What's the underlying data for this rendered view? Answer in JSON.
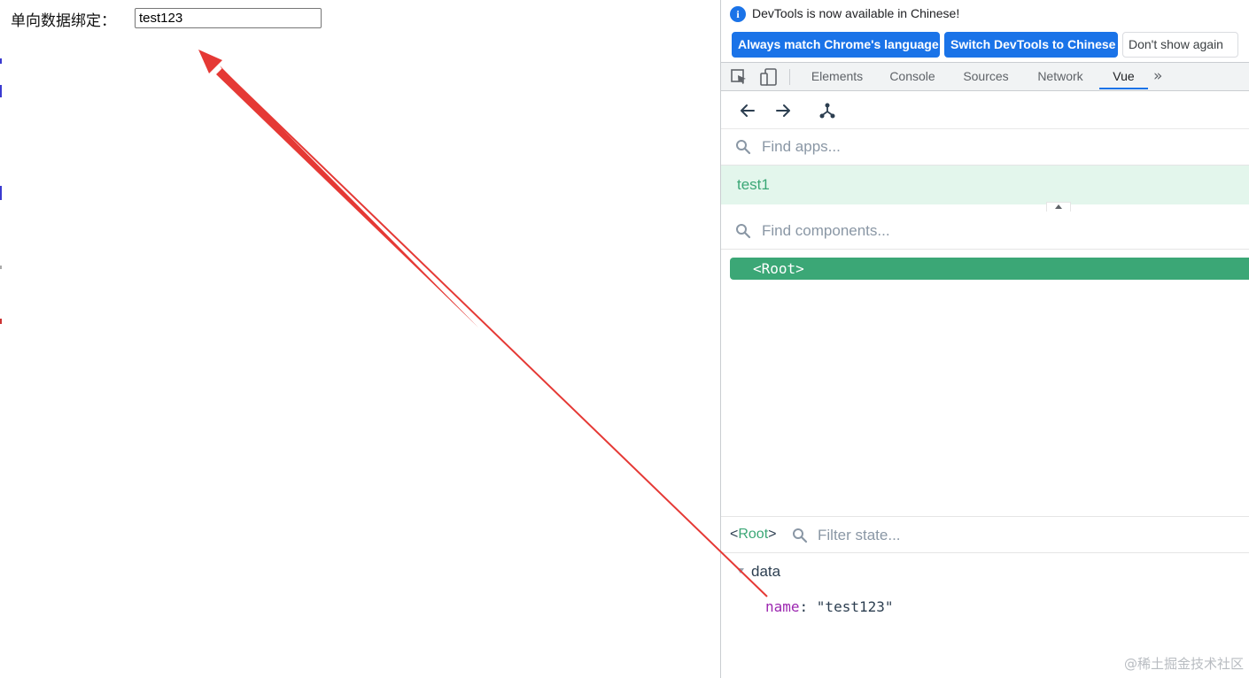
{
  "page": {
    "label": "单向数据绑定：",
    "input_value": "test123"
  },
  "devtools": {
    "infobar": {
      "message": "DevTools is now available in Chinese!",
      "btn_match": "Always match Chrome's language",
      "btn_switch": "Switch DevTools to Chinese",
      "btn_dont": "Don't show again"
    },
    "tabs": [
      "Elements",
      "Console",
      "Sources",
      "Network",
      "Vue"
    ],
    "active_tab": "Vue",
    "more_tabs": "»"
  },
  "vue": {
    "apps_placeholder": "Find apps...",
    "app_name": "test1",
    "components_placeholder": "Find components...",
    "root_component": "<Root>",
    "state": {
      "component_open": "<",
      "component_name": "Root",
      "component_close": ">",
      "filter_placeholder": "Filter state...",
      "section": "data",
      "key": "name",
      "colon": ": ",
      "value": "\"test123\""
    }
  },
  "watermark": "@稀土掘金技术社区",
  "colors": {
    "vue_green": "#3ba776",
    "chrome_blue": "#1a73e8",
    "arrow_red": "#e53935"
  }
}
